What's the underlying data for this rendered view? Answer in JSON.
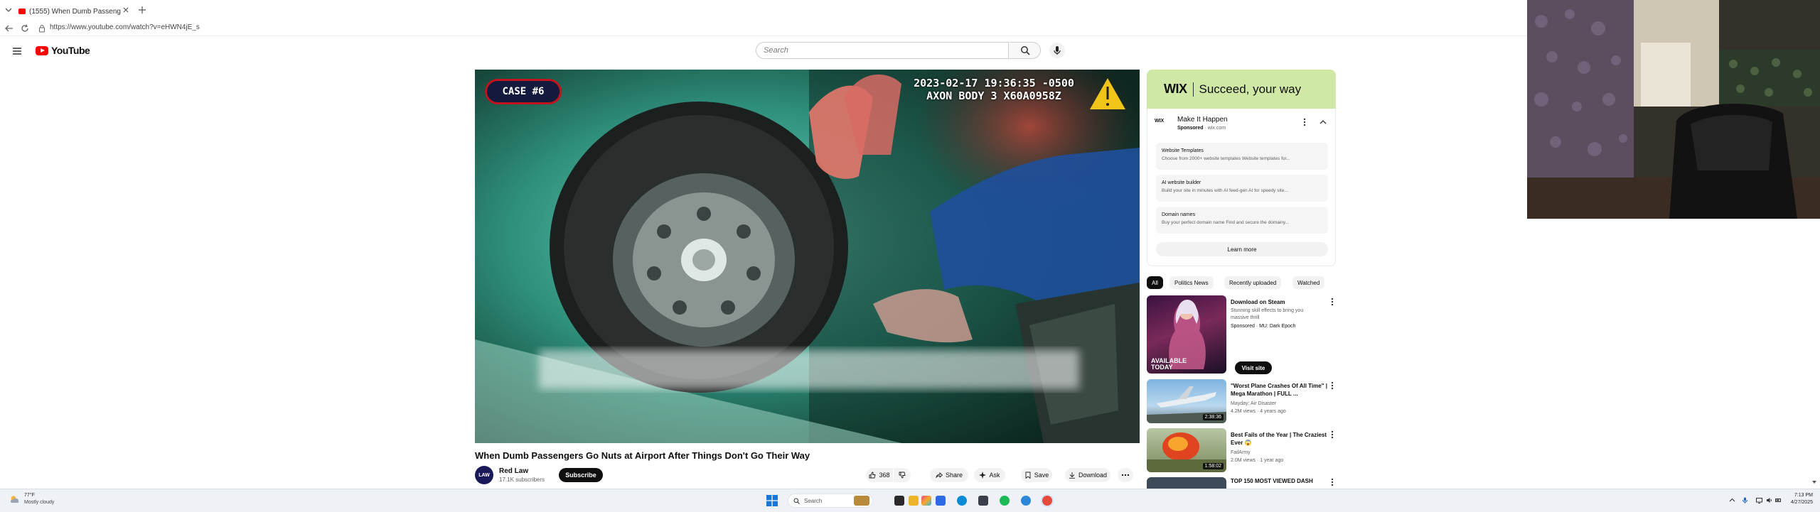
{
  "browser": {
    "tab_title": "(1555) When Dumb Passeng",
    "url": "https://www.youtube.com/watch?v=eHWN4jE_s"
  },
  "header": {
    "logo_text": "YouTube",
    "search_placeholder": "Search"
  },
  "video": {
    "case_label": "CASE #6",
    "bodycam_line1": "2023-02-17 19:36:35 -0500",
    "bodycam_line2": "AXON BODY 3 X60A0958Z",
    "title": "When Dumb Passengers Go Nuts at Airport After Things Don't Go Their Way",
    "channel": "Red Law",
    "subscribers": "17.1K subscribers",
    "subscribe_label": "Subscribe",
    "avatar_text": "LAW",
    "actions": {
      "like_count": "368",
      "share": "Share",
      "ask": "Ask",
      "save": "Save",
      "download": "Download"
    }
  },
  "ad": {
    "banner_logo": "WIX",
    "banner_slogan": "Succeed, your way",
    "mini_logo": "WIX",
    "title": "Make It Happen",
    "sponsored": "Sponsored",
    "domain": "· wix.com",
    "items": [
      {
        "title": "Website Templates",
        "desc": "Choose from 2000+ website templates Website templates for..."
      },
      {
        "title": "AI website builder",
        "desc": "Build your site in minutes with AI feed-gen AI for speedy site..."
      },
      {
        "title": "Domain names",
        "desc": "Buy your perfect domain name Find and secure the domainy..."
      }
    ],
    "learn_more": "Learn more"
  },
  "chips": [
    "All",
    "Politics News",
    "Recently uploaded",
    "Watched"
  ],
  "recommendations": [
    {
      "title": "Download on Steam",
      "line1": "Stunning skill effects to bring you",
      "line2": "massive thrill",
      "line3": "Sponsored · MU: Dark Epoch",
      "cta": "Visit site",
      "thumb_text": "AVAILABLE TODAY"
    },
    {
      "title": "\"Worst Plane Crashes Of All Time\" | Mega Marathon | FULL ...",
      "line1": "Mayday: Air Disaster",
      "line2": "4.2M views · 4 years ago",
      "duration": "2:38:36"
    },
    {
      "title": "Best Fails of the Year | The Craziest Ever 😱",
      "line1": "FailArmy",
      "line2": "2.0M views · 1 year ago",
      "duration": "1:58:02"
    },
    {
      "title": "TOP 150 MOST VIEWED DASH"
    }
  ],
  "taskbar": {
    "weather_temp": "77°F",
    "weather_desc": "Mostly cloudy",
    "search": "Search",
    "time": "7:13 PM",
    "date": "4/27/2025"
  },
  "colors": {
    "yt_red": "#ff0000",
    "ad_green": "#cfe8a6",
    "case_red": "#c0141d"
  }
}
